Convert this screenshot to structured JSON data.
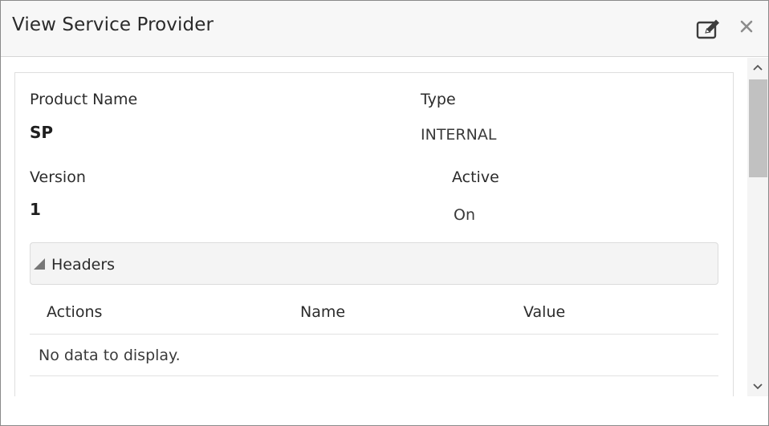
{
  "dialog": {
    "title": "View Service Provider",
    "edit_icon": "edit-icon",
    "close_icon": "close-icon",
    "close_glyph": "✕"
  },
  "fields": {
    "product_name": {
      "label": "Product Name",
      "value": "SP"
    },
    "type": {
      "label": "Type",
      "value": "INTERNAL"
    },
    "version": {
      "label": "Version",
      "value": "1"
    },
    "active": {
      "label": "Active",
      "value": "On"
    }
  },
  "headers_section": {
    "title": "Headers",
    "expanded": true,
    "columns": [
      "Actions",
      "Name",
      "Value"
    ],
    "rows": [],
    "empty_message": "No data to display."
  },
  "scrollbar": {
    "up_icon": "chevron-up-icon",
    "down_icon": "chevron-down-icon"
  },
  "colors": {
    "header_bg": "#f7f7f7",
    "section_bg": "#f4f4f4",
    "border": "#dcdcdc",
    "text": "#2b2b2b"
  }
}
